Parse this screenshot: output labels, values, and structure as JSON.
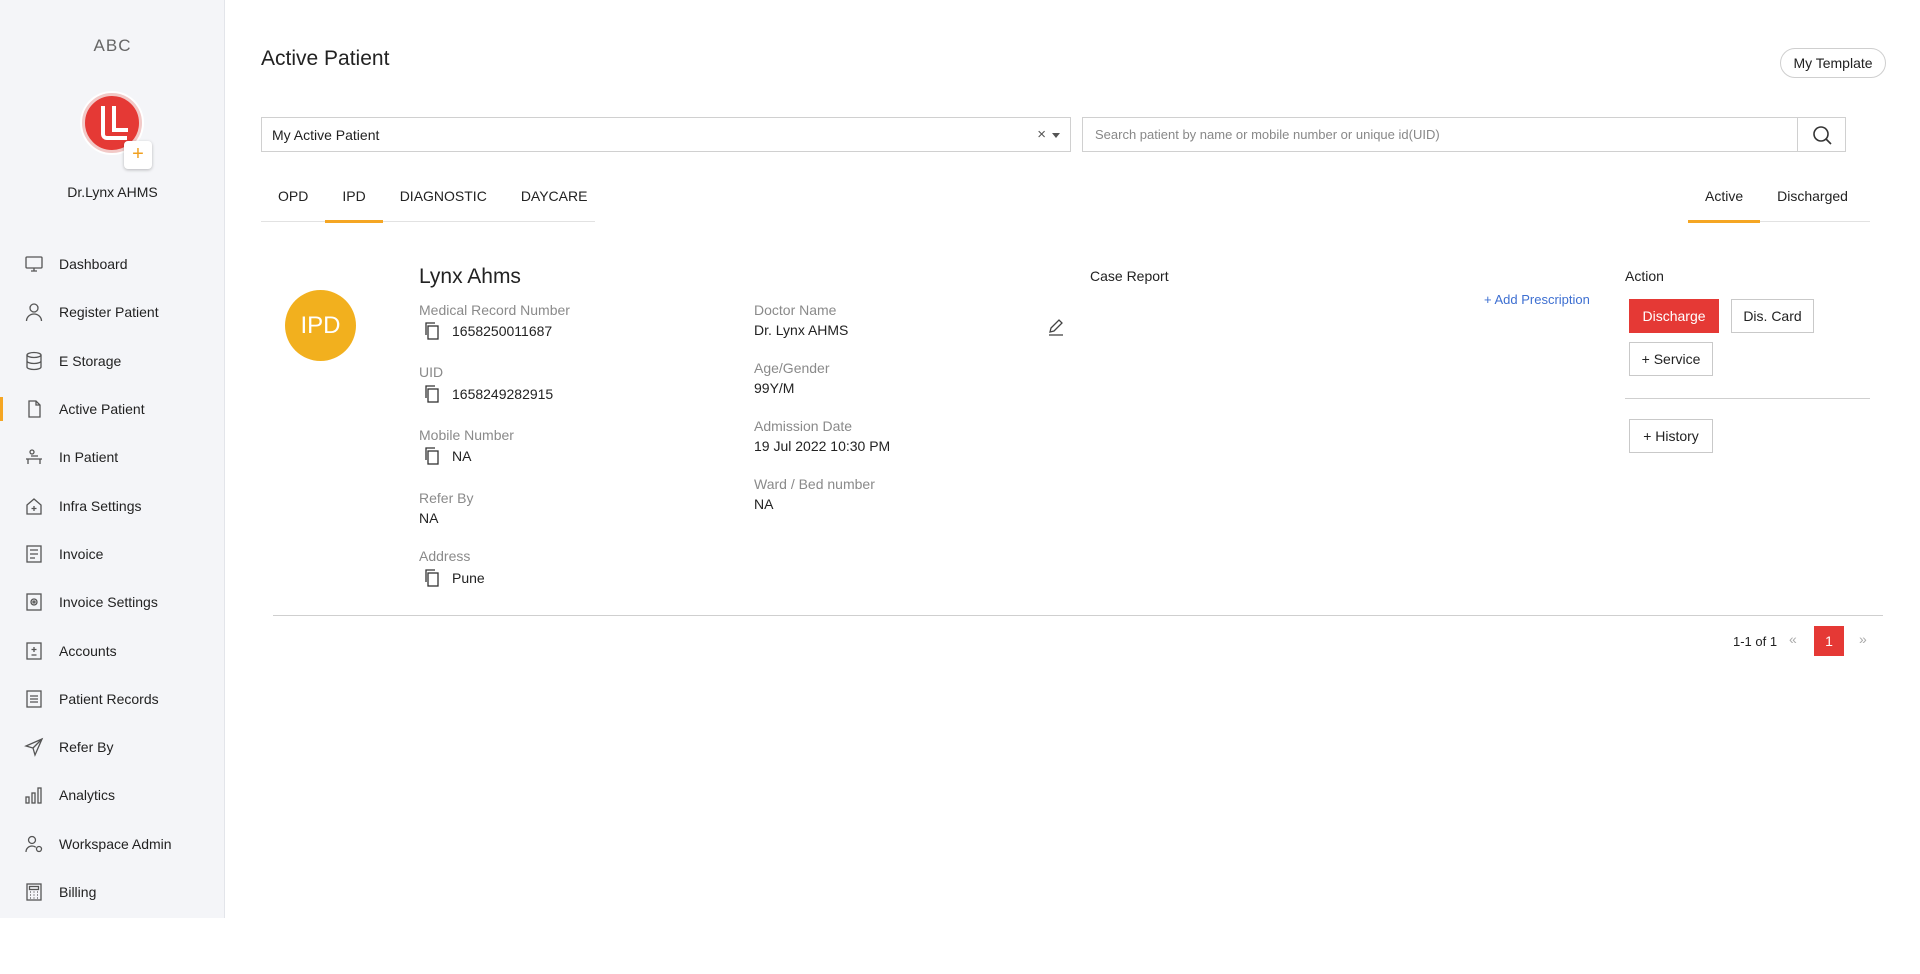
{
  "sidebar": {
    "org_name": "ABC",
    "user_name": "Dr.Lynx AHMS",
    "avatar_add": "+",
    "items": [
      {
        "label": "Dashboard",
        "icon": "monitor-icon"
      },
      {
        "label": "Register Patient",
        "icon": "user-icon"
      },
      {
        "label": "E Storage",
        "icon": "database-icon"
      },
      {
        "label": "Active Patient",
        "icon": "file-icon",
        "active": true
      },
      {
        "label": "In Patient",
        "icon": "bed-icon"
      },
      {
        "label": "Infra Settings",
        "icon": "home-plus-icon"
      },
      {
        "label": "Invoice",
        "icon": "invoice-icon"
      },
      {
        "label": "Invoice Settings",
        "icon": "invoice-settings-icon"
      },
      {
        "label": "Accounts",
        "icon": "accounts-icon"
      },
      {
        "label": "Patient Records",
        "icon": "records-icon"
      },
      {
        "label": "Refer By",
        "icon": "send-icon"
      },
      {
        "label": "Analytics",
        "icon": "bar-chart-icon"
      },
      {
        "label": "Workspace Admin",
        "icon": "admin-user-icon"
      },
      {
        "label": "Billing",
        "icon": "calculator-icon"
      }
    ]
  },
  "header": {
    "title": "Active Patient",
    "template_button": "My Template"
  },
  "filter": {
    "selected": "My Active Patient",
    "clear": "×",
    "search_placeholder": "Search patient by name or mobile number or unique id(UID)"
  },
  "tabs_left": [
    {
      "label": "OPD",
      "active": false
    },
    {
      "label": "IPD",
      "active": true
    },
    {
      "label": "DIAGNOSTIC",
      "active": false
    },
    {
      "label": "DAYCARE",
      "active": false
    }
  ],
  "tabs_right": [
    {
      "label": "Active",
      "active": true
    },
    {
      "label": "Discharged",
      "active": false
    }
  ],
  "patient": {
    "badge": "IPD",
    "name": "Lynx Ahms",
    "mrn_label": "Medical Record Number",
    "mrn": "1658250011687",
    "uid_label": "UID",
    "uid": "1658249282915",
    "mobile_label": "Mobile Number",
    "mobile": "NA",
    "refer_label": "Refer By",
    "refer": "NA",
    "address_label": "Address",
    "address": "Pune",
    "doctor_label": "Doctor Name",
    "doctor": "Dr. Lynx AHMS",
    "age_label": "Age/Gender",
    "age": "99Y/M",
    "admission_label": "Admission Date",
    "admission": "19 Jul 2022 10:30 PM",
    "ward_label": "Ward / Bed number",
    "ward": "NA"
  },
  "case_report": {
    "title": "Case Report",
    "add_prescription": "+ Add Prescription"
  },
  "actions": {
    "title": "Action",
    "discharge": "Discharge",
    "dis_card": "Dis. Card",
    "service": "+ Service",
    "history": "+ History"
  },
  "pagination": {
    "info": "1-1 of 1",
    "prev": "«",
    "page": "1",
    "next": "»"
  },
  "colors": {
    "accent": "#f5a623",
    "danger": "#e53935",
    "badge": "#f2b01e",
    "link": "#3d6fd1"
  }
}
